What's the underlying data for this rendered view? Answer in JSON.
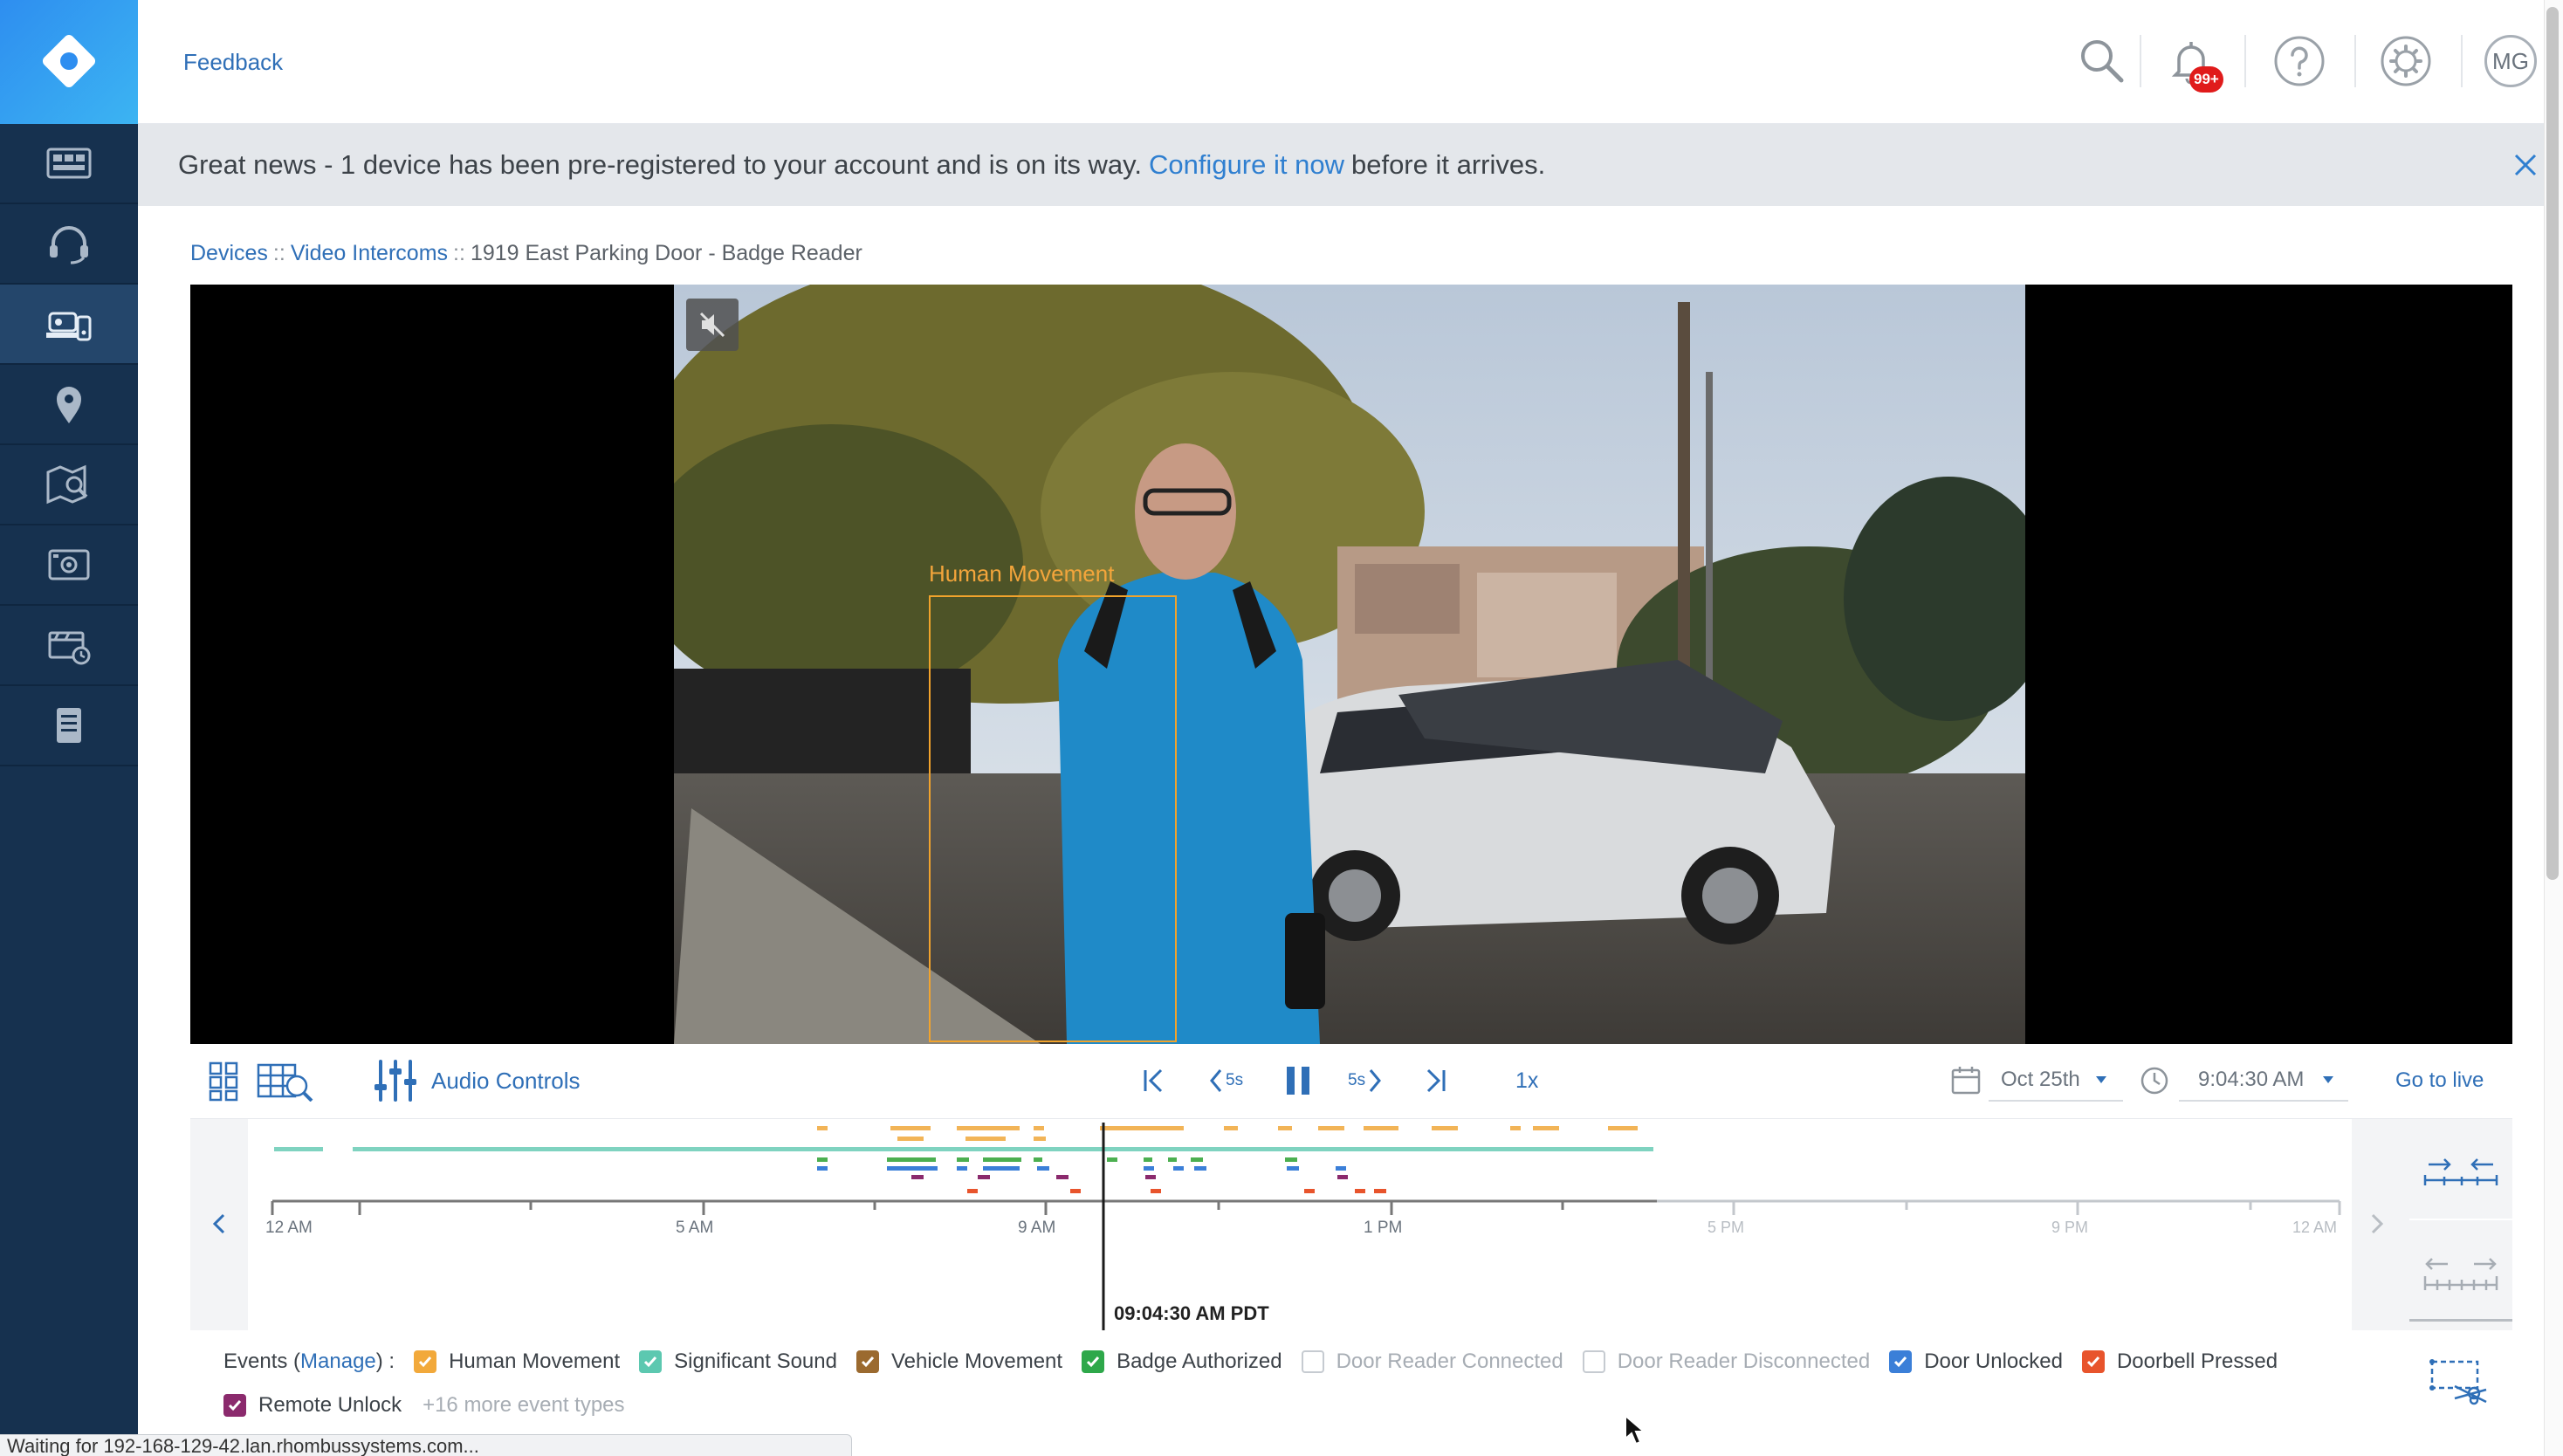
{
  "topbar": {
    "feedback_label": "Feedback",
    "notification_count": "99+",
    "avatar_initials": "MG"
  },
  "banner": {
    "text_before": "Great news - 1 device has been pre-registered to your account and is on its way.",
    "link_text": "Configure it now",
    "text_after": "before it arrives."
  },
  "breadcrumb": {
    "items": [
      "Devices",
      "Video Intercoms",
      "1919 East Parking Door - Badge Reader"
    ],
    "separator": "::"
  },
  "video": {
    "detection_label": "Human Movement"
  },
  "controls": {
    "audio_controls_label": "Audio Controls",
    "rewind_label": "5s",
    "forward_label": "5s",
    "speed": "1x",
    "date": "Oct 25th",
    "time": "9:04:30 AM",
    "go_to_live": "Go to live"
  },
  "timeline": {
    "tick_labels": [
      "12 AM",
      "5 AM",
      "9 AM",
      "1 PM",
      "5 PM",
      "9 PM",
      "12 AM"
    ],
    "playhead_label": "09:04:30 AM PDT"
  },
  "events": {
    "prefix": "Events (",
    "manage_label": "Manage",
    "suffix": ") :",
    "types": [
      {
        "label": "Human Movement",
        "checked": true,
        "color": "#f2a93b"
      },
      {
        "label": "Significant Sound",
        "checked": true,
        "color": "#5cc8b0"
      },
      {
        "label": "Vehicle Movement",
        "checked": true,
        "color": "#9b6a2f"
      },
      {
        "label": "Badge Authorized",
        "checked": true,
        "color": "#2ea84a"
      },
      {
        "label": "Door Reader Connected",
        "checked": false,
        "color": "#c6cbd1"
      },
      {
        "label": "Door Reader Disconnected",
        "checked": false,
        "color": "#c6cbd1"
      },
      {
        "label": "Door Unlocked",
        "checked": true,
        "color": "#3b7fd8"
      },
      {
        "label": "Doorbell Pressed",
        "checked": true,
        "color": "#e8542c"
      },
      {
        "label": "Remote Unlock",
        "checked": true,
        "color": "#8b2a6d"
      }
    ],
    "more_label": "+16 more event types"
  },
  "statusbar": {
    "text": "Waiting for 192-168-129-42.lan.rhombussystems.com..."
  },
  "colors": {
    "sidebar": "#16314f",
    "accent": "#2f6fb7",
    "human_movement": "#f2a93b",
    "significant_sound": "#5cc8b0",
    "badge": "#2ea84a",
    "door_unlocked": "#3b7fd8"
  },
  "icons": {
    "sidebar": [
      "dashboard-icon",
      "support-headset-icon",
      "intercom-devices-icon",
      "location-pin-icon",
      "map-search-icon",
      "camera-grid-icon",
      "video-clips-icon",
      "reports-icon"
    ],
    "topbar": [
      "search-icon",
      "bell-icon",
      "help-icon",
      "settings-gear-icon"
    ]
  }
}
